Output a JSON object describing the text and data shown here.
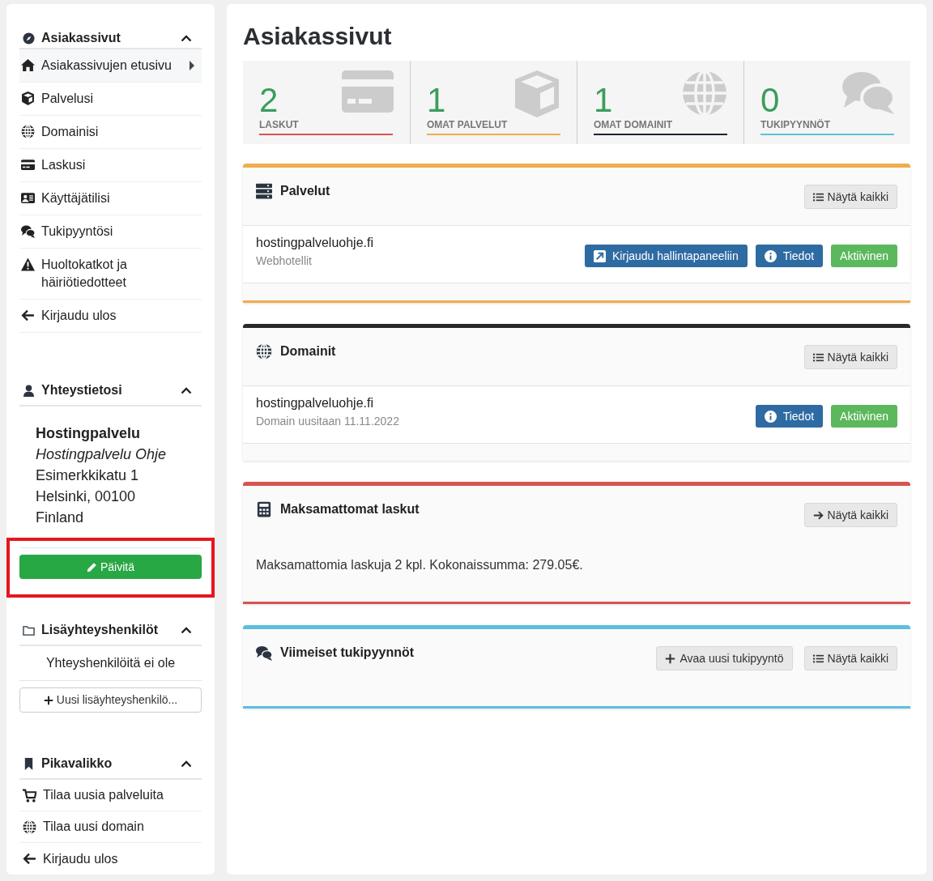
{
  "sidebar": {
    "nav": {
      "title": "Asiakassivut",
      "expanded": true,
      "items": [
        {
          "label": "Asiakassivujen etusivu",
          "selected": true
        },
        {
          "label": "Palvelusi",
          "selected": false
        },
        {
          "label": "Domainisi",
          "selected": false
        },
        {
          "label": "Laskusi",
          "selected": false
        },
        {
          "label": "Käyttäjätilisi",
          "selected": false
        },
        {
          "label": "Tukipyyntösi",
          "selected": false
        },
        {
          "label": "Huoltokatkot ja häiriötiedotteet",
          "selected": false
        },
        {
          "label": "Kirjaudu ulos",
          "selected": false
        }
      ]
    },
    "contact": {
      "title": "Yhteystietosi",
      "expanded": true,
      "company": "Hostingpalvelu",
      "name": "Hostingpalvelu Ohje",
      "street": "Esimerkkikatu 1",
      "city": "Helsinki, 00100",
      "country": "Finland",
      "update_button": {
        "label": "Päivitä",
        "highlighted": true
      }
    },
    "contacts": {
      "title": "Lisäyhteyshenkilöt",
      "expanded": true,
      "empty_text": "Yhteyshenkilöitä ei ole",
      "add_button": "Uusi lisäyhteyshenkilö..."
    },
    "quick": {
      "title": "Pikavalikko",
      "expanded": true,
      "items": [
        {
          "label": "Tilaa uusia palveluita"
        },
        {
          "label": "Tilaa uusi domain"
        },
        {
          "label": "Kirjaudu ulos"
        }
      ]
    }
  },
  "main": {
    "title": "Asiakassivut",
    "stats": [
      {
        "value": "2",
        "label": "LASKUT",
        "color": "#d9534f"
      },
      {
        "value": "1",
        "label": "OMAT PALVELUT",
        "color": "#f0ad4e"
      },
      {
        "value": "1",
        "label": "OMAT DOMAINIT",
        "color": "#1a2533"
      },
      {
        "value": "0",
        "label": "TUKIPYYNNÖT",
        "color": "#5bc0de"
      }
    ],
    "panels": [
      {
        "title": "Palvelut",
        "color": "#f0ad4e",
        "bottom_line": true,
        "header_buttons": [
          {
            "label": "Näytä kaikki",
            "kind": "list"
          }
        ],
        "rows": [
          {
            "name": "hostingpalveluohje.fi",
            "detail": "Webhotellit",
            "buttons": [
              {
                "label": "Kirjaudu hallintapaneeliin",
                "kind": "login"
              },
              {
                "label": "Tiedot",
                "kind": "info"
              },
              {
                "label": "Aktiivinen",
                "kind": "status"
              }
            ]
          }
        ]
      },
      {
        "title": "Domainit",
        "color": "#292929",
        "bottom_line": false,
        "header_buttons": [
          {
            "label": "Näytä kaikki",
            "kind": "list"
          }
        ],
        "rows": [
          {
            "name": "hostingpalveluohje.fi",
            "detail": "Domain uusitaan 11.11.2022",
            "buttons": [
              {
                "label": "Tiedot",
                "kind": "info"
              },
              {
                "label": "Aktiivinen",
                "kind": "status"
              }
            ]
          }
        ]
      },
      {
        "title": "Maksamattomat laskut",
        "color": "#d9534f",
        "bottom_line": true,
        "header_buttons": [
          {
            "label": "Näytä kaikki",
            "kind": "arrow"
          }
        ],
        "text": "Maksamattomia laskuja 2 kpl. Kokonaissumma: 279.05€."
      },
      {
        "title": "Viimeiset tukipyynnöt",
        "color": "#5bc0de",
        "bottom_line": true,
        "header_buttons": [
          {
            "label": "Avaa uusi tukipyyntö",
            "kind": "add"
          },
          {
            "label": "Näytä kaikki",
            "kind": "list"
          }
        ]
      }
    ]
  }
}
